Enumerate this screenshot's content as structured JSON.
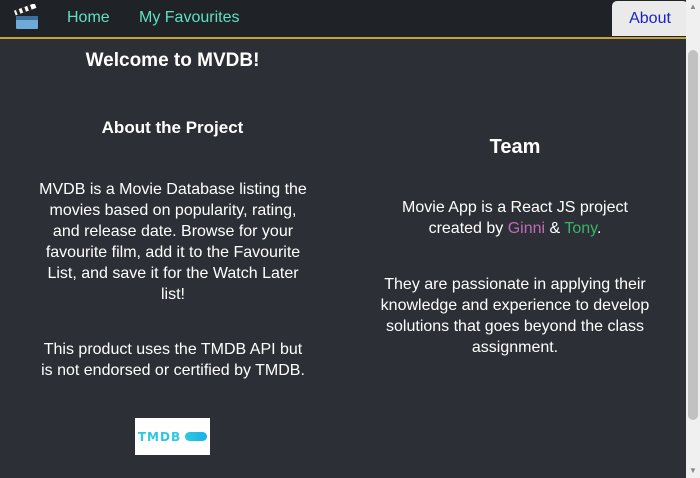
{
  "nav": {
    "home_label": "Home",
    "favourites_label": "My Favourites",
    "about_label": "About"
  },
  "about": {
    "welcome": "Welcome to MVDB!",
    "title": "About the Project",
    "description": "MVDB is a Movie Database listing the movies based on popularity, rating, and release date. Browse for your favourite film, add it to the Favourite List, and save it for the Watch Later list!",
    "tmdb_note": "This product uses the TMDB API but is not endorsed or certified by TMDB.",
    "tmdb_logo_text": "TMDB"
  },
  "team": {
    "title": "Team",
    "intro_before": "Movie App is a React JS project created by ",
    "member_1": "Ginni",
    "joiner": " & ",
    "member_2": "Tony",
    "intro_after": ".",
    "description": "They are passionate in applying their knowledge and experience to develop solutions that goes beyond the class assignment."
  },
  "colors": {
    "nav_link": "#5fe0c0",
    "about_text": "#1a22c7",
    "accent_border": "#c9a13a",
    "ginni": "#c06bb8",
    "tony": "#35b56a",
    "background": "#2c2f36"
  },
  "icons": {
    "logo": "clapperboard-icon"
  }
}
